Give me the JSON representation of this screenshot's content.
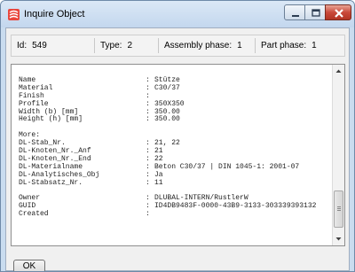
{
  "window": {
    "title": "Inquire Object"
  },
  "info": {
    "id_label": "Id:",
    "id_value": "549",
    "type_label": "Type:",
    "type_value": "2",
    "assembly_label": "Assembly phase:",
    "assembly_value": "1",
    "part_label": "Part phase:",
    "part_value": "1"
  },
  "properties": [
    {
      "key": "Name",
      "colon": ":",
      "value": "Stütze"
    },
    {
      "key": "Material",
      "colon": ":",
      "value": "C30/37"
    },
    {
      "key": "Finish",
      "colon": ":",
      "value": ""
    },
    {
      "key": "Profile",
      "colon": ":",
      "value": "350X350"
    },
    {
      "key": "Width (b) [mm]",
      "colon": ":",
      "value": "350.00"
    },
    {
      "key": "Height (h) [mm]",
      "colon": ":",
      "value": "350.00"
    },
    {
      "key": "",
      "colon": "",
      "value": ""
    },
    {
      "key": "More:",
      "colon": "",
      "value": ""
    },
    {
      "key": "DL-Stab_Nr.",
      "colon": ":",
      "value": "21, 22"
    },
    {
      "key": "DL-Knoten_Nr._Anf",
      "colon": ":",
      "value": "21"
    },
    {
      "key": "DL-Knoten_Nr._End",
      "colon": ":",
      "value": "22"
    },
    {
      "key": "DL-Materialname",
      "colon": ":",
      "value": "Beton C30/37 | DIN 1045-1: 2001-07"
    },
    {
      "key": "DL-Analytisches_Obj",
      "colon": ":",
      "value": "Ja"
    },
    {
      "key": "DL-Stabsatz_Nr.",
      "colon": ":",
      "value": "11"
    },
    {
      "key": "",
      "colon": "",
      "value": ""
    },
    {
      "key": "Owner",
      "colon": ":",
      "value": "DLUBAL-INTERN/RustlerW"
    },
    {
      "key": "GUID",
      "colon": ":",
      "value": "ID4DB9483F-0000-43B9-3133-303339393132"
    },
    {
      "key": "Created",
      "colon": ":",
      "value": ""
    }
  ],
  "buttons": {
    "ok": "OK"
  },
  "icons": {
    "app": "inquire-object-icon",
    "minimize": "minimize-icon",
    "maximize": "maximize-icon",
    "close": "close-icon"
  },
  "colors": {
    "close_button": "#c9493a",
    "titlebar": "#c9dcef"
  }
}
